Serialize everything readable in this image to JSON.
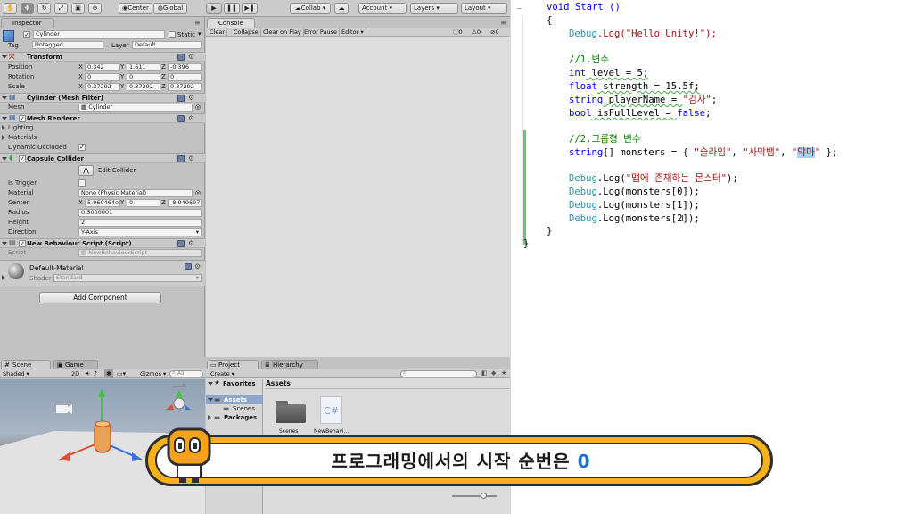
{
  "toolbar": {
    "center": "Center",
    "global": "Global",
    "collab": "Collab",
    "account": "Account",
    "layers": "Layers",
    "layout": "Layout"
  },
  "inspector": {
    "tab": "Inspector",
    "object_name": "Cylinder",
    "static": "Static",
    "tag_label": "Tag",
    "tag_value": "Untagged",
    "layer_label": "Layer",
    "layer_value": "Default",
    "transform": {
      "title": "Transform",
      "position_label": "Position",
      "rotation_label": "Rotation",
      "scale_label": "Scale",
      "position": {
        "x": "0.342",
        "y": "1.611",
        "z": "-0.396"
      },
      "rotation": {
        "x": "0",
        "y": "0",
        "z": "0"
      },
      "scale": {
        "x": "0.37292",
        "y": "0.37292",
        "z": "0.37292"
      }
    },
    "mesh_filter": {
      "title": "Cylinder (Mesh Filter)",
      "mesh_label": "Mesh",
      "mesh_value": "Cylinder"
    },
    "mesh_renderer": {
      "title": "Mesh Renderer",
      "lighting": "Lighting",
      "materials": "Materials",
      "dynamic_occluded": "Dynamic Occluded"
    },
    "capsule_collider": {
      "title": "Capsule Collider",
      "edit_collider": "Edit Collider",
      "is_trigger": "Is Trigger",
      "material_label": "Material",
      "material_value": "None (Physic Material)",
      "center_label": "Center",
      "center": {
        "x": "5.960464e",
        "y": "0",
        "z": "-8.940697"
      },
      "radius_label": "Radius",
      "radius_value": "0.5000001",
      "height_label": "Height",
      "height_value": "2",
      "direction_label": "Direction",
      "direction_value": "Y-Axis"
    },
    "script": {
      "title": "New Behaviour Script (Script)",
      "script_label": "Script",
      "script_value": "NewBehaviourScript"
    },
    "material": {
      "name": "Default-Material",
      "shader_label": "Shader",
      "shader_value": "Standard"
    },
    "add_component": "Add Component"
  },
  "console": {
    "tab": "Console",
    "buttons": [
      "Clear",
      "Collapse",
      "Clear on Play",
      "Error Pause",
      "Editor"
    ],
    "counts": [
      "0",
      "0",
      "0"
    ]
  },
  "scene": {
    "tab_scene": "Scene",
    "tab_game": "Game",
    "shaded": "Shaded",
    "mode_2d": "2D",
    "gizmos": "Gizmos",
    "search": "All"
  },
  "project": {
    "tab_project": "Project",
    "tab_hierarchy": "Hierarchy",
    "create": "Create",
    "favorites": "Favorites",
    "assets": "Assets",
    "scenes": "Scenes",
    "packages": "Packages",
    "breadcrumb": "Assets",
    "items": [
      {
        "label": "Scenes"
      },
      {
        "label": "NewBehavi...",
        "icon_text": "C#"
      }
    ]
  },
  "code": {
    "l1": "void Start ()",
    "l2": "{",
    "debug": "Debug",
    "log_hello": ".Log(\"Hello Unity!\");",
    "c1": "//1.변수",
    "int_kw": "int",
    "int_rest": " level = 5;",
    "float_kw": "float",
    "float_rest": " strength = 15.5f;",
    "string_kw": "string",
    "string_rest1": " playerName = ",
    "string_val": "\"검사\"",
    "semi": ";",
    "bool_kw": "bool",
    "bool_rest": " isFullLevel = ",
    "false_kw": "false",
    "c2": "//2.그룹형 변수",
    "arr_decl": "[] monsters = { ",
    "m1": "\"슬라임\"",
    "comma": ", ",
    "m2": "\"사막뱀\"",
    "m3q1": "\"",
    "m3sel": "악마",
    "m3q2": "\"",
    "arr_end": " };",
    "log_msg": ".Log(",
    "msg_str": "\"맵에 존재하는 몬스터\"",
    "paren_end": ");",
    "log0": ".Log(monsters[0]);",
    "log1": ".Log(monsters[1]);",
    "log2": ".Log(monsters[2]);",
    "close_inner": "}",
    "close_outer": "}"
  },
  "subtitle": {
    "text": "프로그래밍에서의 시작 순번은 ",
    "highlight": "0"
  },
  "colors": {
    "keyword": "#0000ff",
    "comment": "#008000",
    "string": "#a31515",
    "type": "#2b91af",
    "subtitle_highlight": "#1e6fd9",
    "banner": "#f6b21a"
  }
}
